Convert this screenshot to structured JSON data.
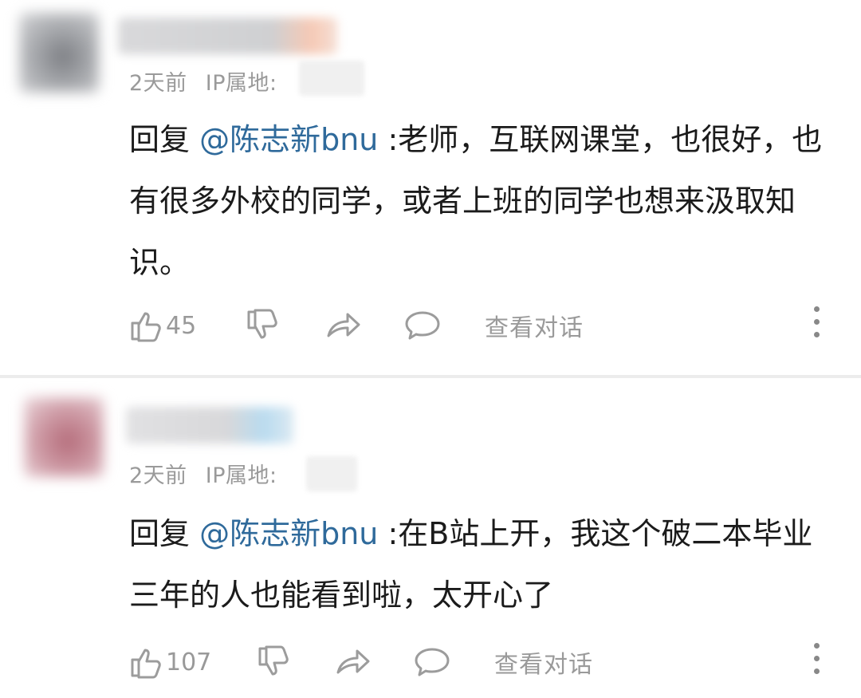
{
  "comments": [
    {
      "time": "2天前",
      "ip_label": "IP属地:",
      "reply_prefix": "回复 ",
      "mention": "@陈志新bnu",
      "text": " :老师，互联网课堂，也很好，也有很多外校的同学，或者上班的同学也想来汲取知识。",
      "likes": "45",
      "view_thread": "查看对话"
    },
    {
      "time": "2天前",
      "ip_label": "IP属地:",
      "reply_prefix": "回复 ",
      "mention": "@陈志新bnu",
      "text": " :在B站上开，我这个破二本毕业三年的人也能看到啦，太开心了",
      "likes": "107",
      "view_thread": "查看对话"
    }
  ],
  "icons": {
    "like": "thumbs-up-icon",
    "dislike": "thumbs-down-icon",
    "share": "share-arrow-icon",
    "reply": "speech-bubble-icon",
    "more": "more-vertical-icon"
  },
  "colors": {
    "mention": "#2f6a9b",
    "meta": "#9a9a9a",
    "text": "#1b1b1b",
    "divider": "#ececec"
  }
}
